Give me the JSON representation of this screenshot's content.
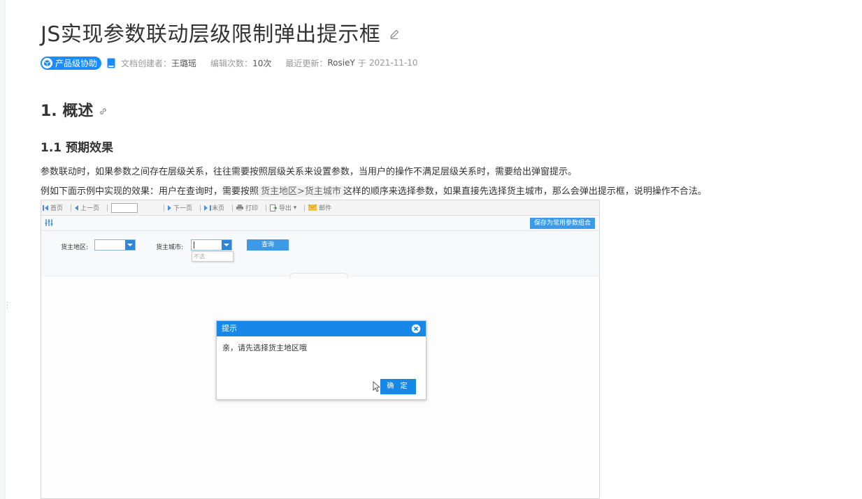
{
  "doc": {
    "title": "JS实现参数联动层级限制弹出提示框",
    "badge": "产品级协助",
    "creator_label": "文档创建者：",
    "creator": "王璐瑶",
    "edit_count_label": "编辑次数：",
    "edit_count": "10次",
    "updated_label": "最近更新：",
    "updated_by": "RosieY",
    "updated_prefix": "于",
    "updated_date": "2021-11-10"
  },
  "section": {
    "h1": "1. 概述",
    "h2": "1.1 预期效果",
    "p1": "参数联动时，如果参数之间存在层级关系，往往需要按照层级关系来设置参数，当用户的操作不满足层级关系时，需要给出弹窗提示。",
    "p2_before": "例如下面示例中实现的效果：用户在查询时，需要按照",
    "p2_code": "货主地区>货主城市",
    "p2_after": "这样的顺序来选择参数，如果直接先选择货主城市，那么会弹出提示框，说明操作不合法。"
  },
  "toolbar": {
    "first": "首页",
    "prev": "上一页",
    "next": "下一页",
    "last": "末页",
    "print": "打印",
    "export": "导出",
    "mail": "邮件"
  },
  "params": {
    "save_combo": "保存为常用参数组合",
    "region_label": "货主地区:",
    "city_label": "货主城市:",
    "dropdown_option": "不选",
    "query": "查询"
  },
  "dialog": {
    "title": "提示",
    "message": "亲，请先选择货主地区哦",
    "ok": "确 定"
  },
  "colors": {
    "accent": "#1a8cff",
    "dialog_blue": "#1787e8"
  }
}
